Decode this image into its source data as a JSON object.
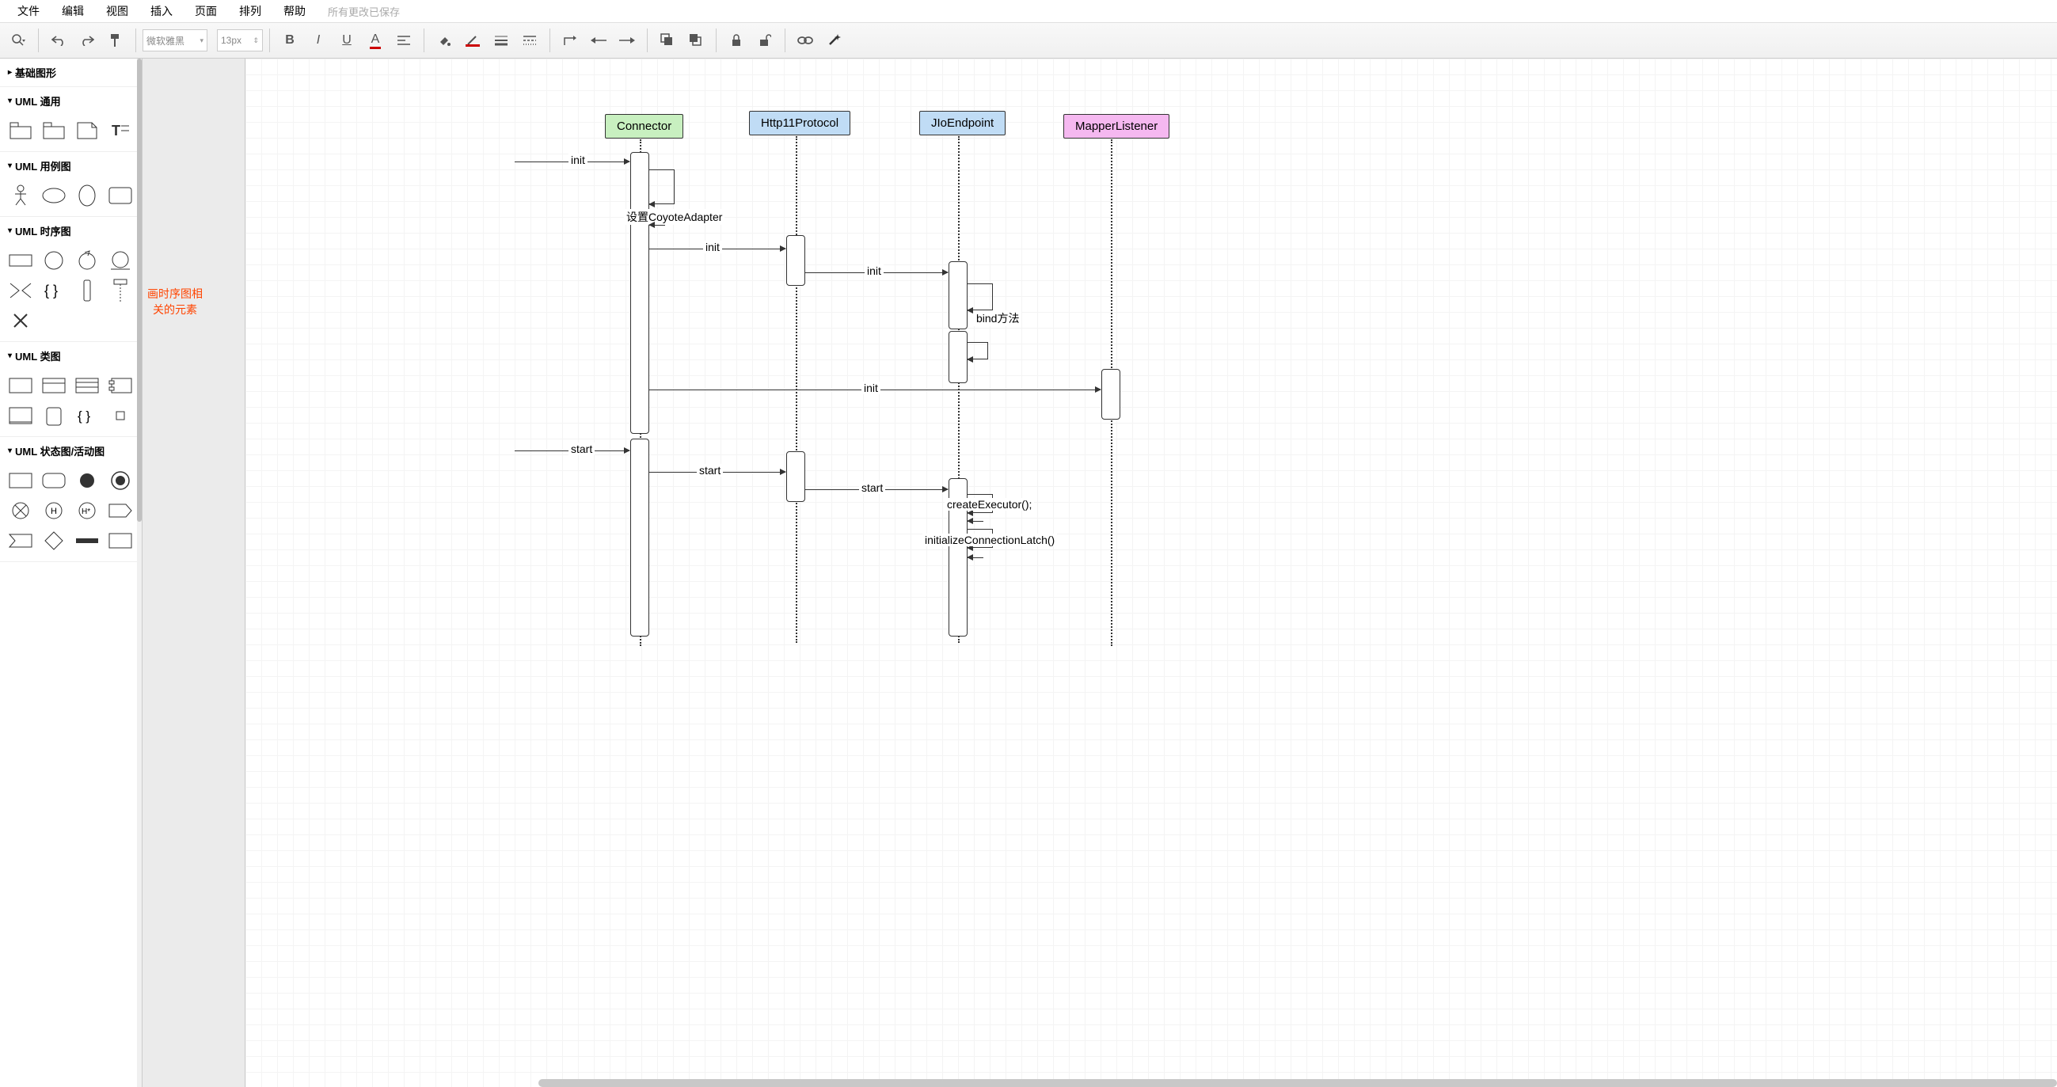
{
  "menubar": {
    "items": [
      "文件",
      "编辑",
      "视图",
      "插入",
      "页面",
      "排列",
      "帮助"
    ],
    "save_status": "所有更改已保存"
  },
  "toolbar": {
    "font": "微软雅黑",
    "size": "13px"
  },
  "sidebar": {
    "sections": [
      {
        "title": "基础图形",
        "collapsed": true
      },
      {
        "title": "UML 通用",
        "collapsed": false
      },
      {
        "title": "UML 用例图",
        "collapsed": false
      },
      {
        "title": "UML 时序图",
        "collapsed": false
      },
      {
        "title": "UML 类图",
        "collapsed": false
      },
      {
        "title": "UML 状态图/活动图",
        "collapsed": false
      }
    ],
    "annotation": "画时序图相\n关的元素"
  },
  "diagram": {
    "participants": [
      {
        "name": "Connector",
        "color": "#c8f0c0"
      },
      {
        "name": "Http11Protocol",
        "color": "#c0dcf5"
      },
      {
        "name": "JIoEndpoint",
        "color": "#c0dcf5"
      },
      {
        "name": "MapperListener",
        "color": "#f5b8f0"
      }
    ],
    "messages": {
      "init1": "init",
      "setAdapter": "设置CoyoteAdapter",
      "init2": "init",
      "init3": "init",
      "bind": "bind方法",
      "init4": "init",
      "start1": "start",
      "start2": "start",
      "start3": "start",
      "createExec": "createExecutor();",
      "initLatch": "initializeConnectionLatch()"
    }
  },
  "chart_data": {
    "type": "sequence-diagram",
    "participants": [
      "Connector",
      "Http11Protocol",
      "JIoEndpoint",
      "MapperListener"
    ],
    "messages": [
      {
        "from": "external",
        "to": "Connector",
        "label": "init"
      },
      {
        "from": "Connector",
        "to": "Connector",
        "label": "设置CoyoteAdapter",
        "self": true
      },
      {
        "from": "Connector",
        "to": "Http11Protocol",
        "label": "init"
      },
      {
        "from": "Http11Protocol",
        "to": "JIoEndpoint",
        "label": "init"
      },
      {
        "from": "JIoEndpoint",
        "to": "JIoEndpoint",
        "label": "bind方法",
        "self": true
      },
      {
        "from": "Connector",
        "to": "MapperListener",
        "label": "init"
      },
      {
        "from": "external",
        "to": "Connector",
        "label": "start"
      },
      {
        "from": "Connector",
        "to": "Http11Protocol",
        "label": "start"
      },
      {
        "from": "Http11Protocol",
        "to": "JIoEndpoint",
        "label": "start"
      },
      {
        "from": "JIoEndpoint",
        "to": "JIoEndpoint",
        "label": "createExecutor();",
        "self": true
      },
      {
        "from": "JIoEndpoint",
        "to": "JIoEndpoint",
        "label": "initializeConnectionLatch()",
        "self": true
      }
    ]
  }
}
